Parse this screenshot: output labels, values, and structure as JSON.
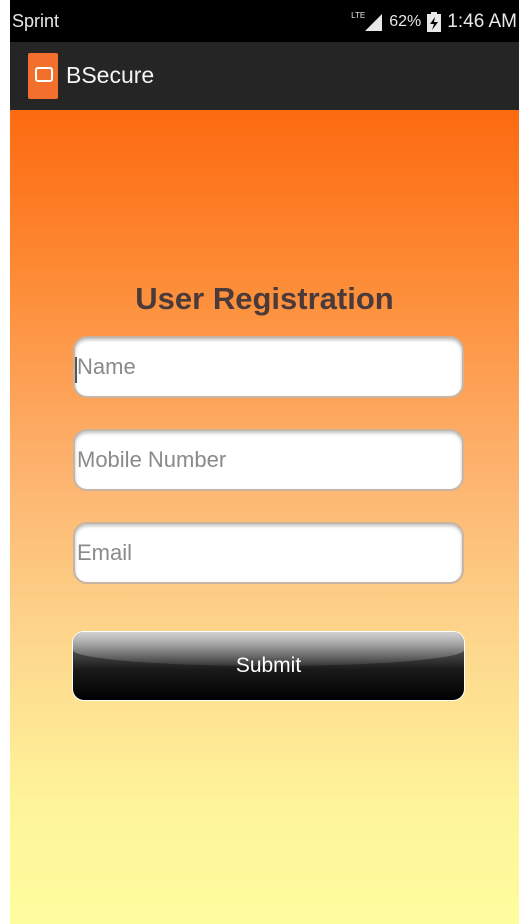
{
  "status_bar": {
    "carrier": "Sprint",
    "network": "LTE",
    "battery": "62%",
    "time": "1:46 AM"
  },
  "app_bar": {
    "title": "BSecure",
    "icon": "app-logo-icon",
    "icon_color": "#f26f2c"
  },
  "form": {
    "heading": "User Registration",
    "name_placeholder": "Name",
    "mobile_placeholder": "Mobile Number",
    "email_placeholder": "Email",
    "submit_label": "Submit"
  },
  "colors": {
    "gradient_top": "#fd6a10",
    "gradient_bottom": "#fefd9e",
    "heading": "#4b3a3a"
  }
}
